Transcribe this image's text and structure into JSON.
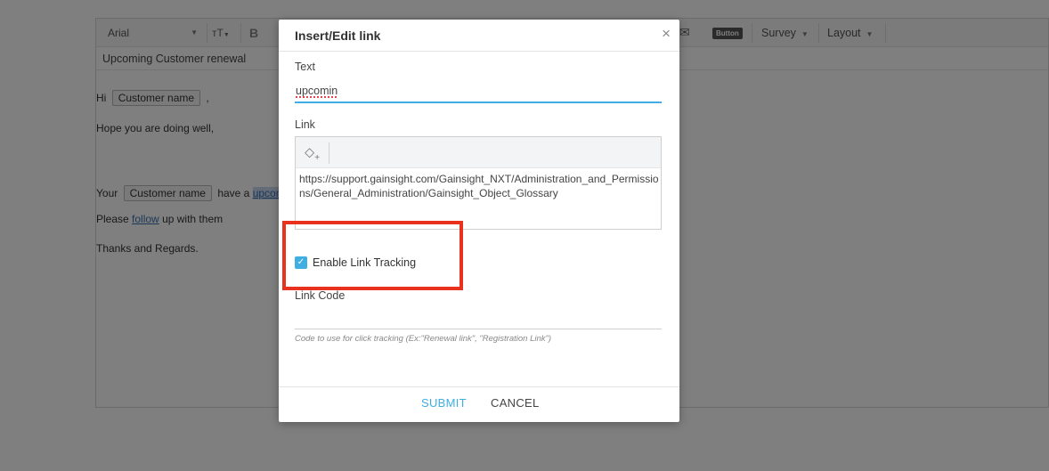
{
  "editor": {
    "toolbar": {
      "font": "Arial",
      "size_icon": "тT",
      "bold": "B",
      "button_chip": "Button",
      "survey": "Survey",
      "layout": "Layout"
    },
    "subject": "Upcoming Customer renewal",
    "body": {
      "greeting": "Hi",
      "customer_token": "Customer name",
      "greeting_end": ",",
      "line2": "Hope you are doing well,",
      "line3_prefix": "Your",
      "line3_token": "Customer name",
      "line3_mid": "have a",
      "line3_link": "upcomi",
      "line4_prefix": "Please",
      "line4_link": "follow",
      "line4_suffix": "up with them",
      "line5": "Thanks and Regards."
    }
  },
  "modal": {
    "title": "Insert/Edit link",
    "close": "×",
    "text_label": "Text",
    "text_value": "upcomin",
    "link_label": "Link",
    "link_url": "https://support.gainsight.com/Gainsight_NXT/Administration_and_Permissions/General_Administration/Gainsight_Object_Glossary",
    "tracking_label": "Enable Link Tracking",
    "tracking_checked": true,
    "link_code_label": "Link Code",
    "link_code_value": "",
    "link_code_hint": "Code to use for click tracking (Ex:\"Renewal link\", \"Registration Link\")",
    "submit": "SUBMIT",
    "cancel": "CANCEL"
  },
  "colors": {
    "accent": "#3eaee3",
    "highlight": "#e8321e"
  }
}
